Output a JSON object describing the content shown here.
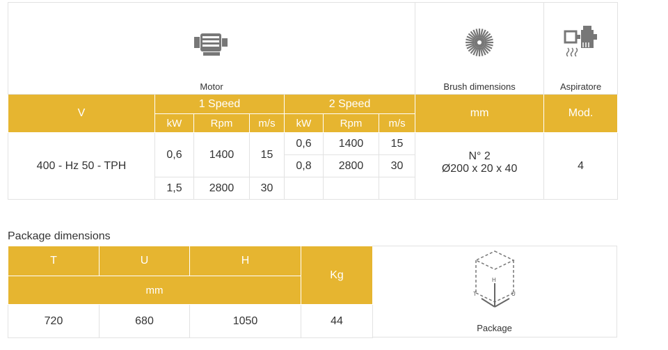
{
  "main": {
    "motor_caption": "Motor",
    "brush_caption": "Brush dimensions",
    "aspirator_caption": "Aspiratore",
    "headers": {
      "v": "V",
      "speed1": "1 Speed",
      "speed2": "2 Speed",
      "mm": "mm",
      "mod": "Mod.",
      "sub": [
        "kW",
        "Rpm",
        "m/s",
        "kW",
        "Rpm",
        "m/s"
      ]
    },
    "voltage": "400 - Hz 50 - TPH",
    "speed1_rows": [
      {
        "kw": "0,6",
        "rpm": "1400",
        "ms": "15"
      },
      {
        "kw": "1,5",
        "rpm": "2800",
        "ms": "30"
      }
    ],
    "speed2_rows": [
      {
        "kw": "0,6",
        "rpm": "1400",
        "ms": "15"
      },
      {
        "kw": "0,8",
        "rpm": "2800",
        "ms": "30"
      }
    ],
    "brush_line1": "N° 2",
    "brush_line2": "Ø200 x 20 x 40",
    "model": "4"
  },
  "package": {
    "title": "Package dimensions",
    "headers": {
      "t": "T",
      "u": "U",
      "h": "H",
      "kg": "Kg",
      "mm": "mm"
    },
    "values": {
      "t": "720",
      "u": "680",
      "h": "1050",
      "kg": "44"
    },
    "caption": "Package",
    "diagram_labels": {
      "h": "H",
      "t": "T",
      "u": "U"
    }
  },
  "colors": {
    "header_bg": "#e6b530",
    "border": "#e2e2e2",
    "icon": "#777777"
  },
  "icons": [
    "motor-icon",
    "brush-icon",
    "aspirator-icon",
    "package-box-icon"
  ]
}
